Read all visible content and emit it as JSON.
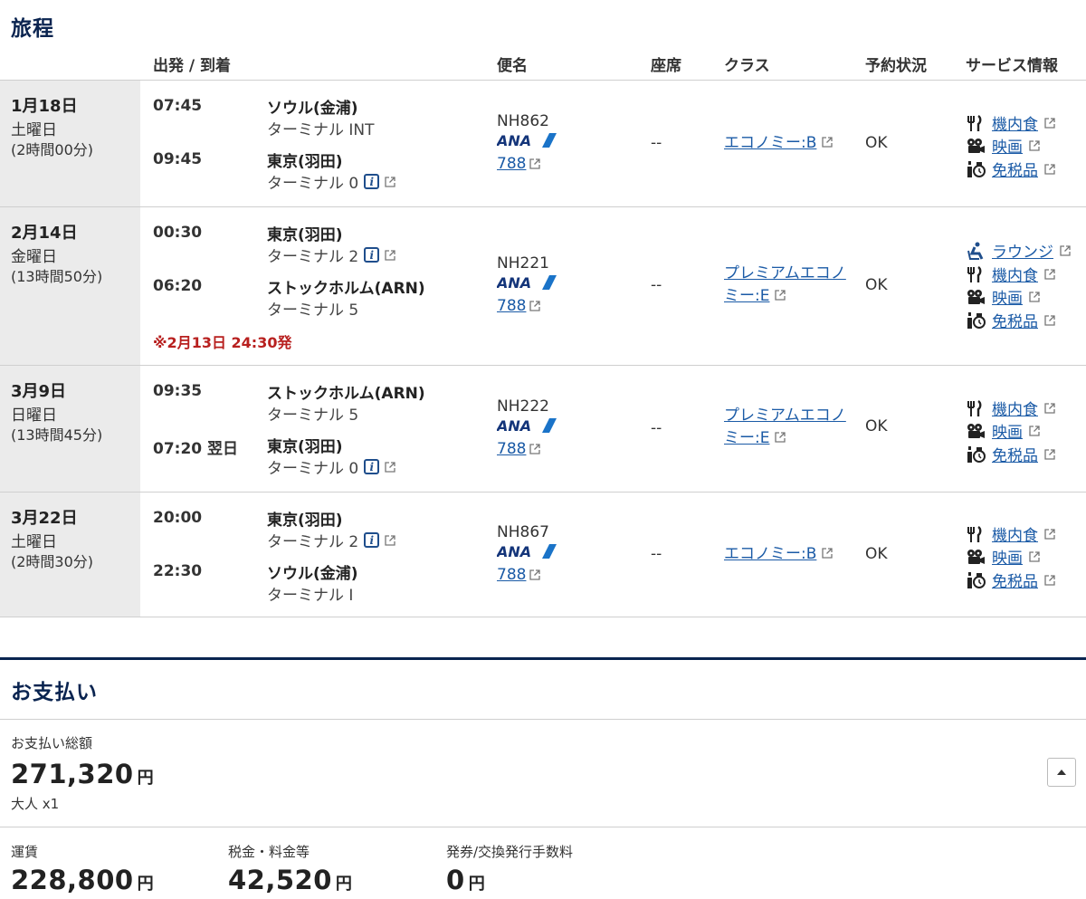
{
  "itinerary": {
    "title": "旅程",
    "headers": {
      "dep_arr": "出発 / 到着",
      "flight": "便名",
      "seat": "座席",
      "class": "クラス",
      "status": "予約状況",
      "service": "サービス情報"
    },
    "segments": [
      {
        "date": "1月18日",
        "dow": "土曜日",
        "duration": "(2時間00分)",
        "dep_time": "07:45",
        "dep_city": "ソウル(金浦)",
        "dep_terminal": "ターミナル INT",
        "arr_time": "09:45",
        "arr_city": "東京(羽田)",
        "arr_terminal": "ターミナル 0",
        "flight_no": "NH862",
        "airline_logo": "ANA",
        "aircraft": "788",
        "seat": "--",
        "class_label": "エコノミー:B",
        "status": "OK",
        "services": [
          "機内食",
          "映画",
          "免税品"
        ]
      },
      {
        "date": "2月14日",
        "dow": "金曜日",
        "duration": "(13時間50分)",
        "dep_time": "00:30",
        "dep_city": "東京(羽田)",
        "dep_terminal": "ターミナル 2",
        "arr_time": "06:20",
        "arr_city": "ストックホルム(ARN)",
        "arr_terminal": "ターミナル 5",
        "note": "※2月13日 24:30発",
        "flight_no": "NH221",
        "airline_logo": "ANA",
        "aircraft": "788",
        "seat": "--",
        "class_line1": "プレミアムエコノ",
        "class_line2": "ミー:E",
        "status": "OK",
        "services": [
          "ラウンジ",
          "機内食",
          "映画",
          "免税品"
        ]
      },
      {
        "date": "3月9日",
        "dow": "日曜日",
        "duration": "(13時間45分)",
        "dep_time": "09:35",
        "dep_city": "ストックホルム(ARN)",
        "dep_terminal": "ターミナル 5",
        "arr_time": "07:20 翌日",
        "arr_city": "東京(羽田)",
        "arr_terminal": "ターミナル 0",
        "flight_no": "NH222",
        "airline_logo": "ANA",
        "aircraft": "788",
        "seat": "--",
        "class_line1": "プレミアムエコノ",
        "class_line2": "ミー:E",
        "status": "OK",
        "services": [
          "機内食",
          "映画",
          "免税品"
        ]
      },
      {
        "date": "3月22日",
        "dow": "土曜日",
        "duration": "(2時間30分)",
        "dep_time": "20:00",
        "dep_city": "東京(羽田)",
        "dep_terminal": "ターミナル 2",
        "arr_time": "22:30",
        "arr_city": "ソウル(金浦)",
        "arr_terminal": "ターミナル I",
        "flight_no": "NH867",
        "airline_logo": "ANA",
        "aircraft": "788",
        "seat": "--",
        "class_label": "エコノミー:B",
        "status": "OK",
        "services": [
          "機内食",
          "映画",
          "免税品"
        ]
      }
    ]
  },
  "payment": {
    "title": "お支払い",
    "total_label": "お支払い総額",
    "total_amount": "271,320",
    "currency": "円",
    "passengers": "大人 x1",
    "fare_label": "運賃",
    "fare_amount": "228,800",
    "tax_label": "税金・料金等",
    "tax_amount": "42,520",
    "fee_label": "発券/交換発行手数料",
    "fee_amount": "0"
  },
  "colors": {
    "navy": "#0a2450",
    "link": "#1a5aa6",
    "note_red": "#b8201f",
    "date_bg": "#ebebeb"
  }
}
